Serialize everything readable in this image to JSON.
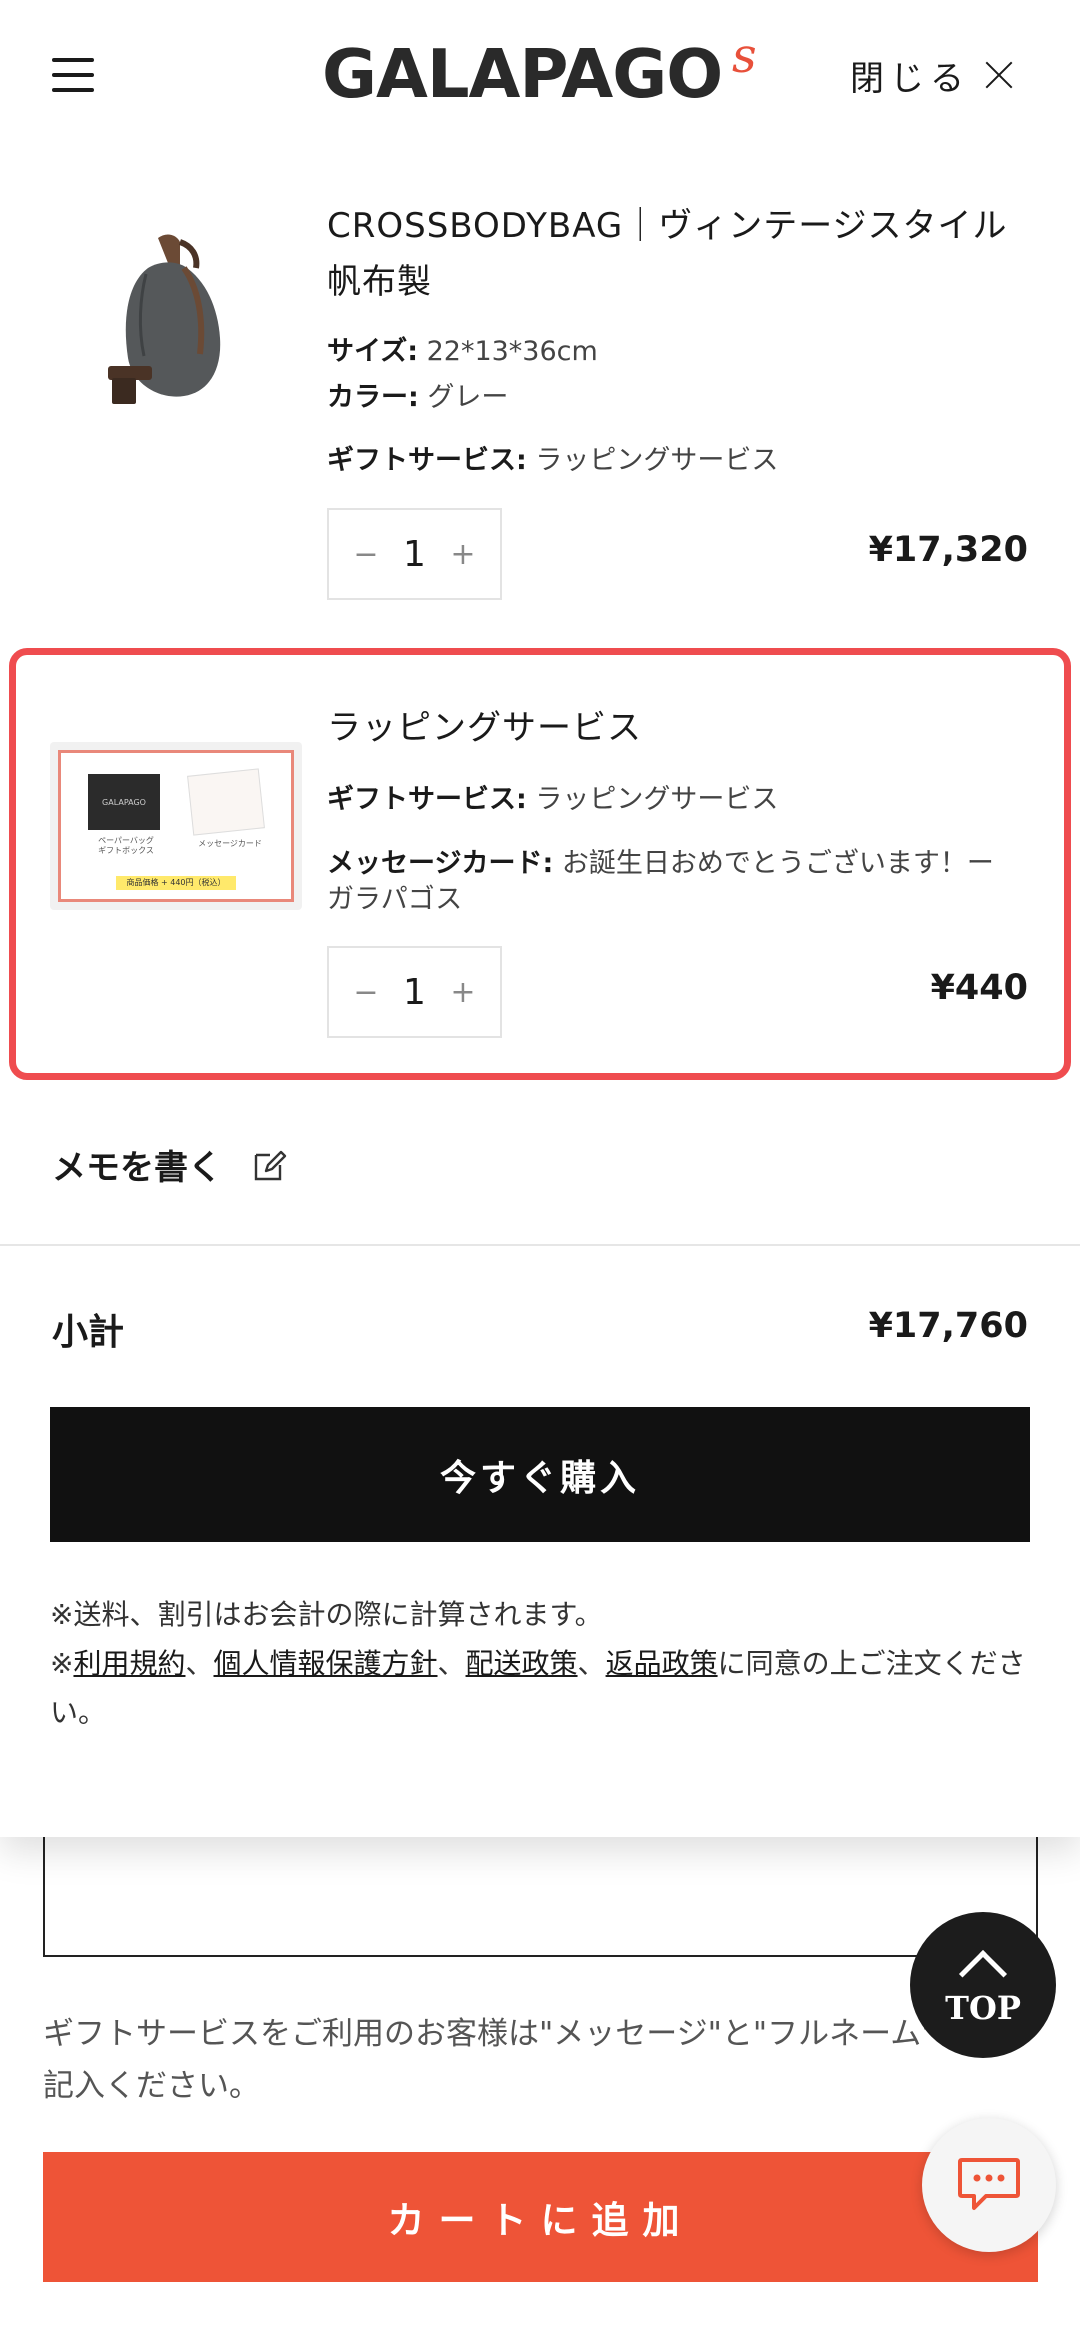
{
  "header": {
    "logo": "GALAPAGO",
    "logo_mark": "s",
    "close_label": "閉じる"
  },
  "cart": {
    "items": [
      {
        "title": "CROSSBODYBAG｜ヴィンテージスタイル帆布製",
        "props": [
          {
            "key": "サイズ:",
            "value": " 22*13*36cm"
          },
          {
            "key": "カラー:",
            "value": " グレー"
          },
          {
            "key": "ギフトサービス:",
            "value": " ラッピングサービス"
          }
        ],
        "quantity": "1",
        "price": "¥17,320"
      },
      {
        "title": "ラッピングサービス",
        "props": [
          {
            "key": "ギフトサービス:",
            "value": " ラッピングサービス"
          },
          {
            "key": "メッセージカード:",
            "value": " お誕生日おめでとうございます！ーガラパゴス"
          }
        ],
        "quantity": "1",
        "price": "¥440",
        "image_texts": {
          "box_logo": "GALAPAGO",
          "left_caption": "ペーパーバッグ\nギフトボックス",
          "right_caption": "メッセージカード",
          "price_note": "商品価格 + 440円（税込）"
        }
      }
    ],
    "qty_minus": "−",
    "qty_plus": "+",
    "memo_label": "メモを書く",
    "subtotal_label": "小計",
    "subtotal_value": "¥17,760",
    "buy_label": "今すぐ購入",
    "note_line1": "※送料、割引はお会計の際に計算されます。",
    "note_prefix": "※",
    "links": [
      "利用規約",
      "個人情報保護方針",
      "配送政策",
      "返品政策"
    ],
    "sep": "、",
    "note_suffix": "に同意の上ご注文ください。"
  },
  "background_page": {
    "gift_note": "ギフトサービスをご利用のお客様は\"メッセージ\"と\"フルネーム\"をご記入ください。",
    "add_to_cart": "カートに追加"
  },
  "floating": {
    "top_label": "TOP"
  },
  "colors": {
    "accent": "#ee5437",
    "highlight": "#ef4c4f",
    "buy_button": "#111111"
  }
}
